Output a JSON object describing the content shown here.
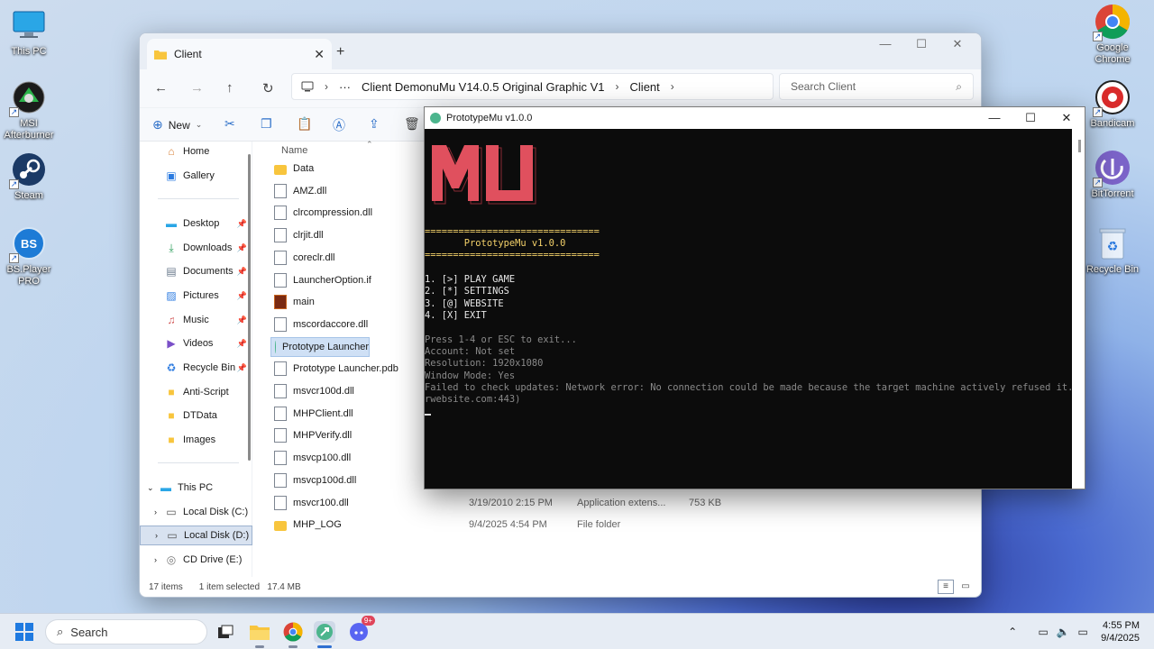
{
  "desktop": {
    "icons_left": [
      {
        "label": "This PC",
        "icon": "monitor-icon"
      },
      {
        "label": "MSI Afterburner",
        "icon": "afterburner-icon"
      },
      {
        "label": "Steam",
        "icon": "steam-icon"
      },
      {
        "label": "BS.Player PRO",
        "icon": "bsplayer-icon"
      }
    ],
    "icons_right": [
      {
        "label": "Google Chrome",
        "icon": "chrome-icon"
      },
      {
        "label": "Bandicam",
        "icon": "bandicam-icon"
      },
      {
        "label": "BitTorrent",
        "icon": "bittorrent-icon"
      },
      {
        "label": "Recycle Bin",
        "icon": "recycle-bin-icon"
      }
    ]
  },
  "explorer": {
    "tab_title": "Client",
    "address": {
      "segments": [
        "Client DemonuMu V14.0.5 Original Graphic V1",
        "Client"
      ],
      "ellipsis": "···"
    },
    "search_placeholder": "Search Client",
    "toolbar": {
      "new_label": "New"
    },
    "nav": [
      {
        "label": "Home",
        "icon": "home-icon",
        "pinned": false
      },
      {
        "label": "Gallery",
        "icon": "gallery-icon",
        "pinned": false
      },
      {
        "label": "Desktop",
        "icon": "desktop-icon",
        "pinned": true
      },
      {
        "label": "Downloads",
        "icon": "downloads-icon",
        "pinned": true
      },
      {
        "label": "Documents",
        "icon": "documents-icon",
        "pinned": true
      },
      {
        "label": "Pictures",
        "icon": "pictures-icon",
        "pinned": true
      },
      {
        "label": "Music",
        "icon": "music-icon",
        "pinned": true
      },
      {
        "label": "Videos",
        "icon": "videos-icon",
        "pinned": true
      },
      {
        "label": "Recycle Bin",
        "icon": "recycle-bin-icon",
        "pinned": true
      },
      {
        "label": "Anti-Script",
        "icon": "folder-icon",
        "pinned": false
      },
      {
        "label": "DTData",
        "icon": "folder-icon",
        "pinned": false
      },
      {
        "label": "Images",
        "icon": "folder-icon",
        "pinned": false
      },
      {
        "label": "This PC",
        "icon": "this-pc-icon",
        "pinned": false
      },
      {
        "label": "Local Disk (C:)",
        "icon": "drive-icon",
        "pinned": false
      },
      {
        "label": "Local Disk (D:)",
        "icon": "drive-icon",
        "pinned": false
      },
      {
        "label": "CD Drive (E:)",
        "icon": "cd-drive-icon",
        "pinned": false
      }
    ],
    "column_name": "Name",
    "files": [
      {
        "name": "Data",
        "kind": "folder",
        "date": "",
        "type": "",
        "size": ""
      },
      {
        "name": "AMZ.dll",
        "kind": "doc",
        "date": "",
        "type": "",
        "size": ""
      },
      {
        "name": "clrcompression.dll",
        "kind": "doc",
        "date": "",
        "type": "",
        "size": ""
      },
      {
        "name": "clrjit.dll",
        "kind": "doc",
        "date": "",
        "type": "",
        "size": ""
      },
      {
        "name": "coreclr.dll",
        "kind": "doc",
        "date": "",
        "type": "",
        "size": ""
      },
      {
        "name": "LauncherOption.if",
        "kind": "doc",
        "date": "",
        "type": "",
        "size": ""
      },
      {
        "name": "main",
        "kind": "app",
        "date": "",
        "type": "",
        "size": ""
      },
      {
        "name": "mscordaccore.dll",
        "kind": "doc",
        "date": "",
        "type": "",
        "size": ""
      },
      {
        "name": "Prototype Launcher",
        "kind": "launcher",
        "date": "",
        "type": "",
        "size": ""
      },
      {
        "name": "Prototype Launcher.pdb",
        "kind": "doc",
        "date": "",
        "type": "",
        "size": ""
      },
      {
        "name": "msvcr100d.dll",
        "kind": "doc",
        "date": "",
        "type": "",
        "size": ""
      },
      {
        "name": "MHPClient.dll",
        "kind": "doc",
        "date": "",
        "type": "",
        "size": ""
      },
      {
        "name": "MHPVerify.dll",
        "kind": "doc",
        "date": "",
        "type": "",
        "size": ""
      },
      {
        "name": "msvcp100.dll",
        "kind": "doc",
        "date": "",
        "type": "",
        "size": ""
      },
      {
        "name": "msvcp100d.dll",
        "kind": "doc",
        "date": "",
        "type": "",
        "size": ""
      },
      {
        "name": "msvcr100.dll",
        "kind": "doc",
        "date": "3/19/2010 2:15 PM",
        "type": "Application extens...",
        "size": "753 KB"
      },
      {
        "name": "MHP_LOG",
        "kind": "folder",
        "date": "9/4/2025 4:54 PM",
        "type": "File folder",
        "size": ""
      }
    ],
    "status": {
      "items": "17 items",
      "selected": "1 item selected",
      "size": "17.4 MB"
    }
  },
  "console": {
    "title": "PrototypeMu v1.0.0",
    "logo_text": "MU",
    "logo_color": "#e0505e",
    "separator": "===============================",
    "header": "       PrototypeMu v1.0.0",
    "menu": [
      "1. [>] PLAY GAME",
      "2. [*] SETTINGS",
      "3. [@] WEBSITE",
      "4. [X] EXIT"
    ],
    "info": [
      "Press 1-4 or ESC to exit...",
      "Account: Not set",
      "Resolution: 1920x1080",
      "Window Mode: Yes",
      "Failed to check updates: Network error: No connection could be made because the target machine actively refused it. (you",
      "rwebsite.com:443)"
    ]
  },
  "taskbar": {
    "search_placeholder": "Search",
    "time": "4:55 PM",
    "date": "9/4/2025",
    "discord_badge": "9+"
  }
}
